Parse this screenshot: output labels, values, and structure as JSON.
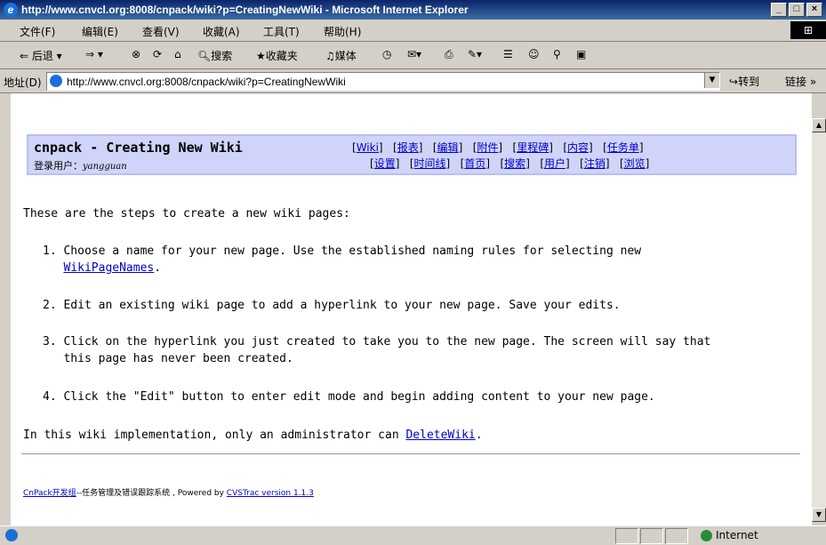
{
  "window": {
    "title": "http://www.cnvcl.org:8008/cnpack/wiki?p=CreatingNewWiki - Microsoft Internet Explorer",
    "buttons": [
      "_",
      "□",
      "×"
    ]
  },
  "menu": [
    "文件(F)",
    "编辑(E)",
    "查看(V)",
    "收藏(A)",
    "工具(T)",
    "帮助(H)"
  ],
  "toolbar": {
    "back": "⇐ 后退 ▾",
    "forward": "⇒ ▾",
    "search": "搜索",
    "favorites": "收藏夹",
    "media": "媒体"
  },
  "address": {
    "label": "地址(D)",
    "url": "http://www.cnvcl.org:8008/cnpack/wiki?p=CreatingNewWiki",
    "go": "转到",
    "links": "链接 »"
  },
  "page": {
    "title": "cnpack - Creating New Wiki",
    "login_label": "登录用户：",
    "login_user": "yangguan",
    "nav_row1": [
      "Wiki",
      "报表",
      "编辑",
      "附件",
      "里程碑",
      "内容",
      "任务单"
    ],
    "nav_row2": [
      "设置",
      "时间线",
      "首页",
      "搜索",
      "用户",
      "注销",
      "浏览"
    ],
    "intro": "These are the steps to create a new wiki pages:",
    "steps": [
      {
        "num": "1.",
        "line1": "Choose a name for your new page. Use the established naming rules for selecting new",
        "link": "WikiPageNames",
        "after": "."
      },
      {
        "num": "2.",
        "line1": "Edit an existing wiki page to add a hyperlink to your new page. Save your edits."
      },
      {
        "num": "3.",
        "line1": "Click on the hyperlink you just created to take you to the new page. The screen will say that",
        "line2": "this page has never been created."
      },
      {
        "num": "4.",
        "line1": "Click the \"Edit\" button to enter edit mode and begin adding content to your new page."
      }
    ],
    "outro_text": "In this wiki implementation, only an administrator can ",
    "outro_link": "DeleteWiki",
    "outro_end": ".",
    "footer_link1": "CnPack开发组",
    "footer_text": "--任务管理及错误跟踪系统 , Powered by ",
    "footer_link2": "CVSTrac version 1.1.3"
  },
  "status": {
    "zone": "Internet"
  }
}
